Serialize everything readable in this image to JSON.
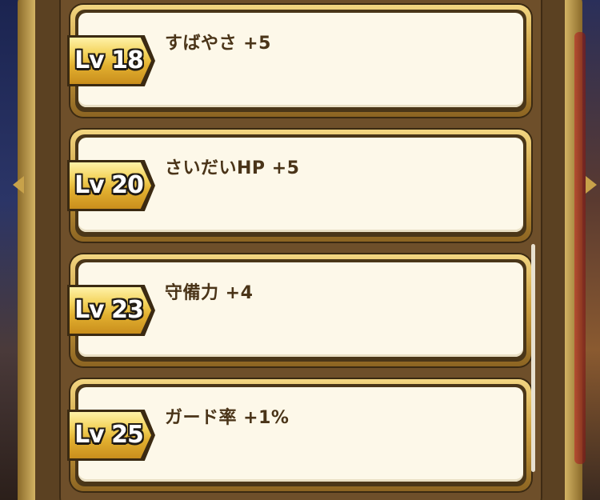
{
  "colors": {
    "card_face": "#fdf8e9",
    "card_text": "#4a3418",
    "badge_gold": "#e2b030",
    "frame_brown": "#6e4f2a"
  },
  "bonuses": [
    {
      "level": "Lv 18",
      "effect": "すばやさ +5"
    },
    {
      "level": "Lv 20",
      "effect": "さいだいHP +5"
    },
    {
      "level": "Lv 23",
      "effect": "守備力 +4"
    },
    {
      "level": "Lv 25",
      "effect": "ガード率 +1%"
    }
  ]
}
